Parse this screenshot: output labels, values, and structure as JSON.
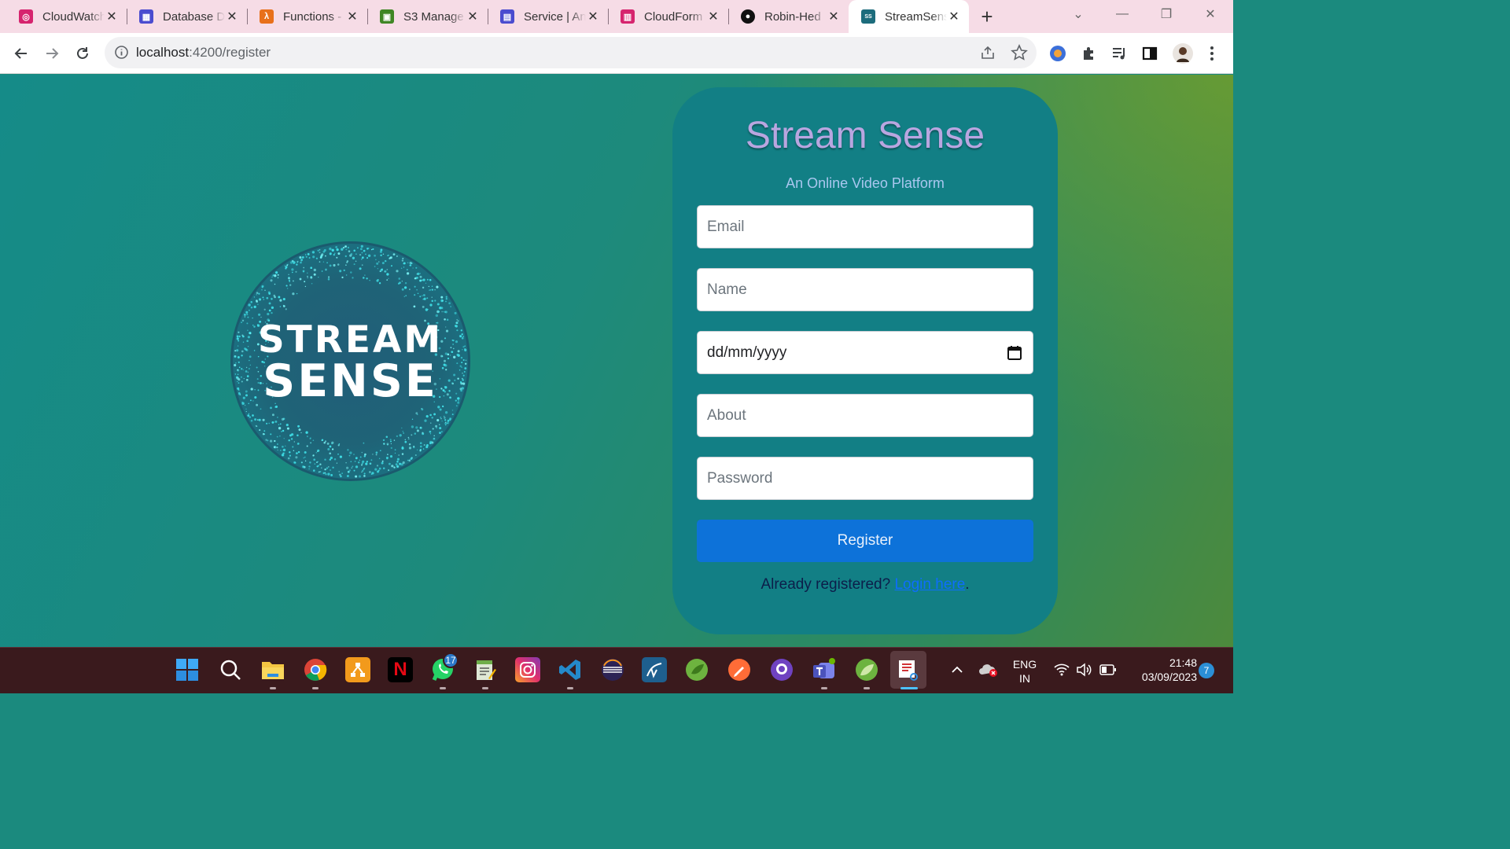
{
  "browser": {
    "tabs": [
      {
        "title": "CloudWatch",
        "icon": "cloudwatch-icon",
        "color": "#d6246e"
      },
      {
        "title": "Database D",
        "icon": "database-icon",
        "color": "#4a4ccf"
      },
      {
        "title": "Functions -",
        "icon": "lambda-icon",
        "color": "#e8701a"
      },
      {
        "title": "S3 Manage",
        "icon": "s3-icon",
        "color": "#3f8624"
      },
      {
        "title": "Service | An",
        "icon": "service-icon",
        "color": "#4a4ccf"
      },
      {
        "title": "CloudForm",
        "icon": "cloudformation-icon",
        "color": "#d6246e"
      },
      {
        "title": "Robin-Hed",
        "icon": "github-icon",
        "color": "#111111"
      },
      {
        "title": "StreamSens",
        "icon": "streamsense-favicon",
        "color": "#1c6c7c"
      }
    ],
    "new_tab": "+",
    "url_host": "localhost",
    "url_path": ":4200/register"
  },
  "page": {
    "logo": {
      "line1": "STREAM",
      "line2": "SENSE"
    },
    "title": "Stream Sense",
    "subtitle": "An Online Video Platform",
    "fields": {
      "email_placeholder": "Email",
      "name_placeholder": "Name",
      "date_value": "dd/mm/yyyy",
      "about_placeholder": "About",
      "password_placeholder": "Password"
    },
    "register_label": "Register",
    "already_text": "Already registered? ",
    "login_link": "Login here",
    "period": "."
  },
  "taskbar": {
    "whatsapp_badge": "17",
    "lang_line1": "ENG",
    "lang_line2": "IN",
    "time": "21:48",
    "date": "03/09/2023",
    "notifications": "7"
  }
}
